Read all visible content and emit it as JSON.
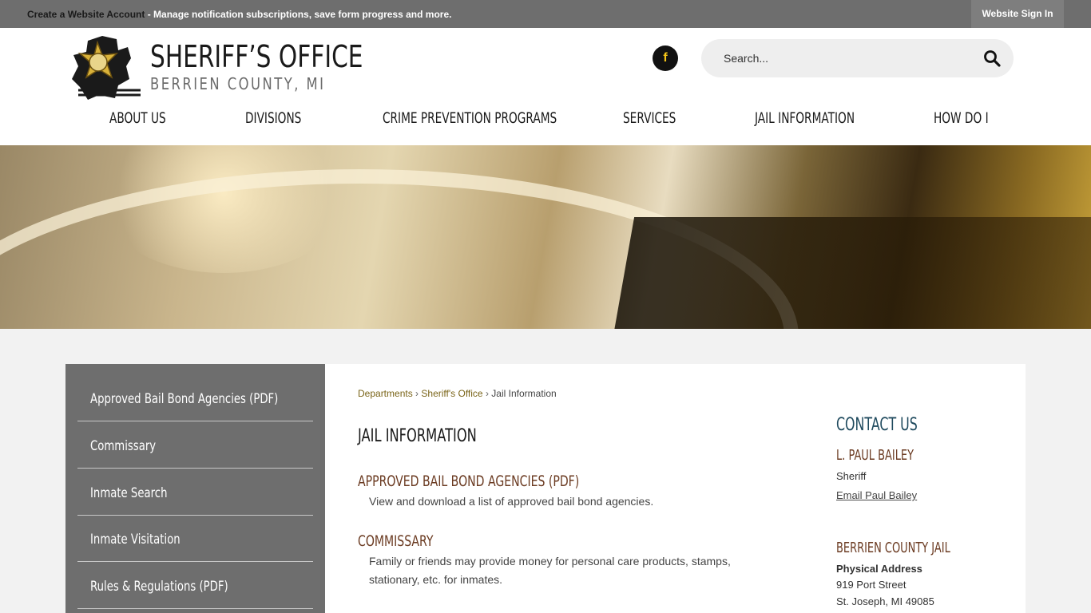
{
  "topbar": {
    "create_bold": "Create a Website Account",
    "create_rest": " - Manage notification subscriptions, save form progress and more.",
    "signin": "Website Sign In"
  },
  "header": {
    "title": "SHERIFF’S OFFICE",
    "subtitle": "BERRIEN COUNTY, MI",
    "facebook_icon": "f",
    "search_placeholder": "Search..."
  },
  "nav": {
    "items": [
      "ABOUT US",
      "DIVISIONS",
      "CRIME PREVENTION PROGRAMS",
      "SERVICES",
      "JAIL INFORMATION",
      "HOW DO I"
    ]
  },
  "sidebar": {
    "items": [
      {
        "label": "Approved Bail Bond Agencies (PDF)"
      },
      {
        "label": "Commissary"
      },
      {
        "label": "Inmate Search"
      },
      {
        "label": "Inmate Visitation"
      },
      {
        "label": "Rules & Regulations (PDF)"
      }
    ]
  },
  "breadcrumb": {
    "items": [
      "Departments",
      "Sheriff's Office",
      "Jail Information"
    ],
    "separator": "›"
  },
  "main": {
    "title": "JAIL INFORMATION",
    "sections": [
      {
        "title": "APPROVED BAIL BOND AGENCIES (PDF)",
        "desc": "View and download a list of approved bail bond agencies."
      },
      {
        "title": "COMMISSARY",
        "desc": "Family or friends may provide money for personal care products, stamps, stationary, etc. for inmates."
      }
    ]
  },
  "contact": {
    "heading": "CONTACT US",
    "person_name": "L. PAUL BAILEY",
    "person_title": "Sheriff",
    "email_link": "Email Paul Bailey",
    "facility_name": "BERRIEN COUNTY JAIL",
    "address_label": "Physical Address",
    "street": "919 Port Street",
    "city": "St. Joseph, MI 49085"
  },
  "colors": {
    "topbar": "#6e6e6e",
    "sidebar": "#6e6e6e",
    "accent_brown": "#6b3b22",
    "accent_teal": "#1f4a5e",
    "breadcrumb_link": "#7a6418",
    "facebook_glyph": "#f5c518"
  }
}
